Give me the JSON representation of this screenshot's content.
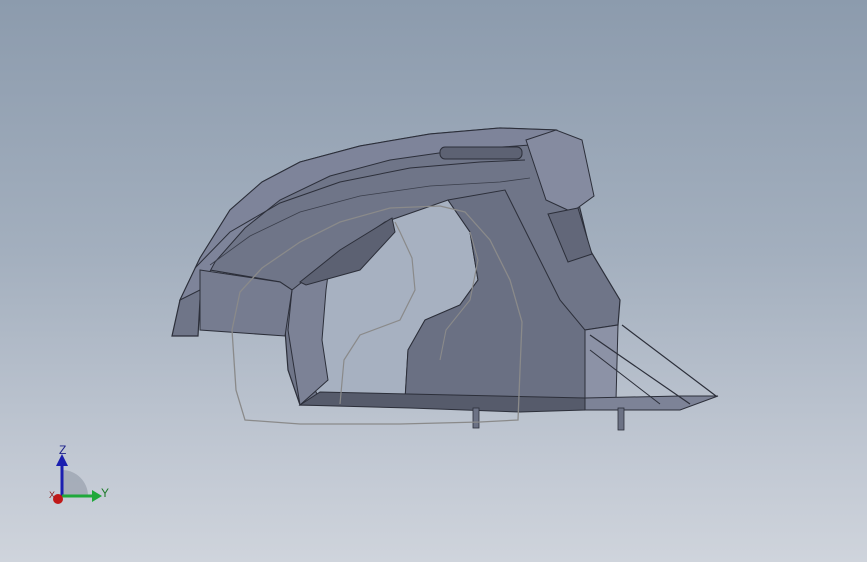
{
  "viewport": {
    "background_top": "#8c9bad",
    "background_bottom": "#cfd4dc"
  },
  "model": {
    "shell_color": "#6e7487",
    "edge_color": "#2c2f3a",
    "sketch_color": "#8a8a8a"
  },
  "triad": {
    "z_label": "Z",
    "y_label": "Y",
    "x_label": "X",
    "z_color": "#1b1fb0",
    "y_color": "#1fa83a",
    "x_color": "#c01818"
  }
}
